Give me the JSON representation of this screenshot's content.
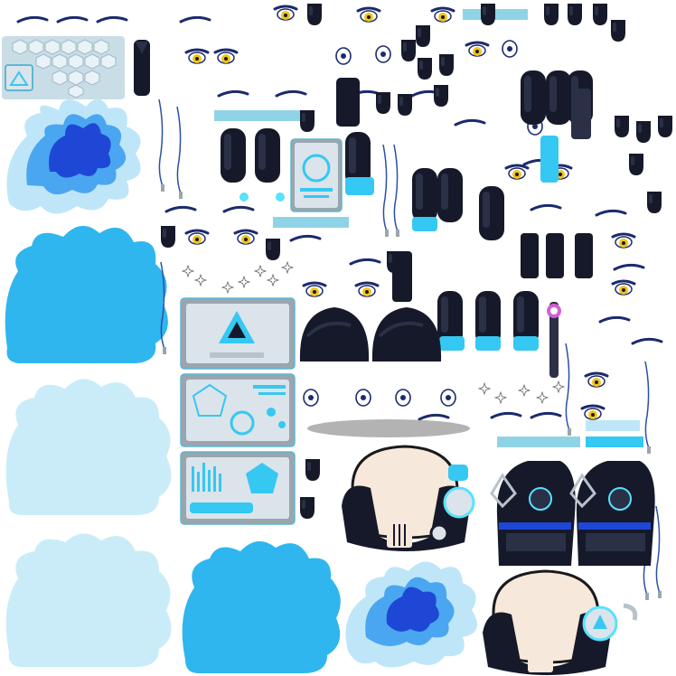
{
  "sheet": {
    "kind": "sprite atlas",
    "background": "#ffffff"
  },
  "palette": {
    "hair_dark": "#1f47d6",
    "hair_mid": "#4aa6f0",
    "hair_light": "#bfe6f8",
    "cyan": "#35c8f2",
    "sky": "#2fb6ee",
    "pale": "#c9ecf8",
    "armor": "#16192a",
    "armor_hi": "#2a3046",
    "panel_grey": "#9aa6ae",
    "panel_light": "#dbe4ea",
    "eye_yellow": "#f2c416",
    "brow_navy": "#1c2a6e",
    "skin": "#f6e8da",
    "glow": "#57e2ff",
    "wand_pink": "#d35fd6",
    "shadow": "#9a9a9a"
  },
  "sprites": [
    {
      "name": "hex-panel-icon",
      "group": "ui"
    },
    {
      "name": "hair-tuft-blue-icon",
      "group": "hair"
    },
    {
      "name": "hair-blob-cyan-icon",
      "group": "hair"
    },
    {
      "name": "hair-blob-pale-icon",
      "group": "hair"
    },
    {
      "name": "tech-panel-triangle-icon",
      "group": "ui"
    },
    {
      "name": "tech-panel-pentagon-icon",
      "group": "ui"
    },
    {
      "name": "tech-panel-controls-icon",
      "group": "ui"
    },
    {
      "name": "eye-set-icon",
      "group": "face"
    },
    {
      "name": "brow-icon",
      "group": "face"
    },
    {
      "name": "armor-boot-icon",
      "group": "armor"
    },
    {
      "name": "armor-glove-icon",
      "group": "armor"
    },
    {
      "name": "armor-shoulder-icon",
      "group": "armor"
    },
    {
      "name": "helmet-mask-icon",
      "group": "head"
    },
    {
      "name": "torso-vest-icon",
      "group": "body"
    },
    {
      "name": "wand-icon",
      "group": "prop"
    },
    {
      "name": "cable-icon",
      "group": "prop"
    },
    {
      "name": "sparkle-icon",
      "group": "fx"
    },
    {
      "name": "ground-shadow-icon",
      "group": "fx"
    }
  ]
}
